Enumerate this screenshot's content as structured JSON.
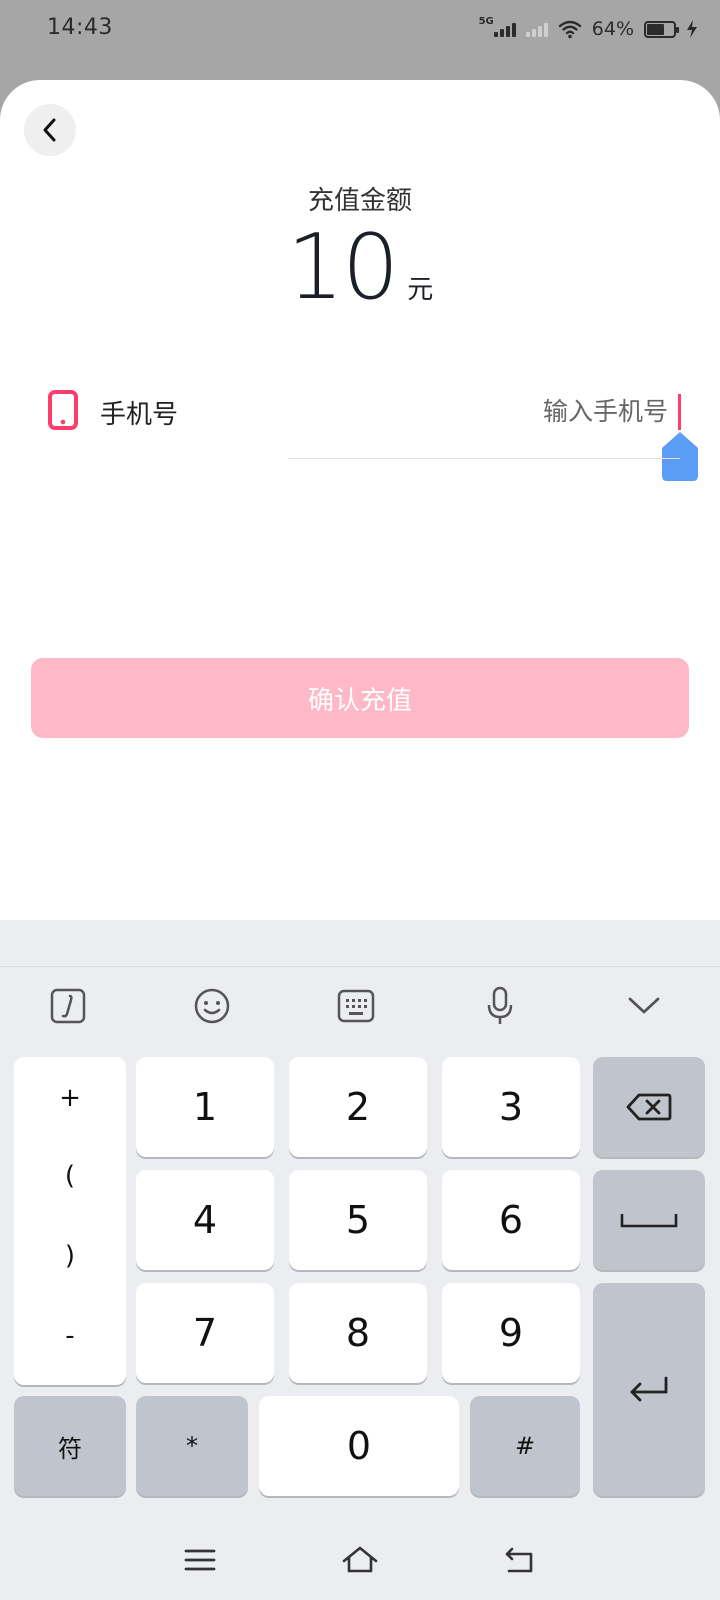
{
  "status_bar": {
    "time": "14:43",
    "network": "5G",
    "battery_text": "64%",
    "battery_level": 0.64
  },
  "recharge": {
    "amount_label": "充值金额",
    "amount_value": "10",
    "amount_unit": "元",
    "phone_label": "手机号",
    "phone_placeholder": "输入手机号",
    "phone_value": "",
    "confirm_label": "确认充值"
  },
  "colors": {
    "accent": "#ff3d6b",
    "confirm_disabled": "#ffb8c6",
    "handle": "#5b9cf7"
  },
  "keyboard": {
    "toolbar_icons": [
      "script-i-icon",
      "emoji-icon",
      "keyboard-icon",
      "microphone-icon",
      "chevron-down-icon"
    ],
    "symbols": [
      "+",
      "(",
      ")",
      "-"
    ],
    "digits": [
      "1",
      "2",
      "3",
      "4",
      "5",
      "6",
      "7",
      "8",
      "9",
      "0"
    ],
    "bottom": {
      "sym_switch": "符",
      "star": "*",
      "hash": "#"
    },
    "function_icons": [
      "backspace-icon",
      "space-icon",
      "enter-icon"
    ]
  },
  "nav_bar": {
    "icons": [
      "menu-icon",
      "home-icon",
      "back-icon"
    ]
  }
}
